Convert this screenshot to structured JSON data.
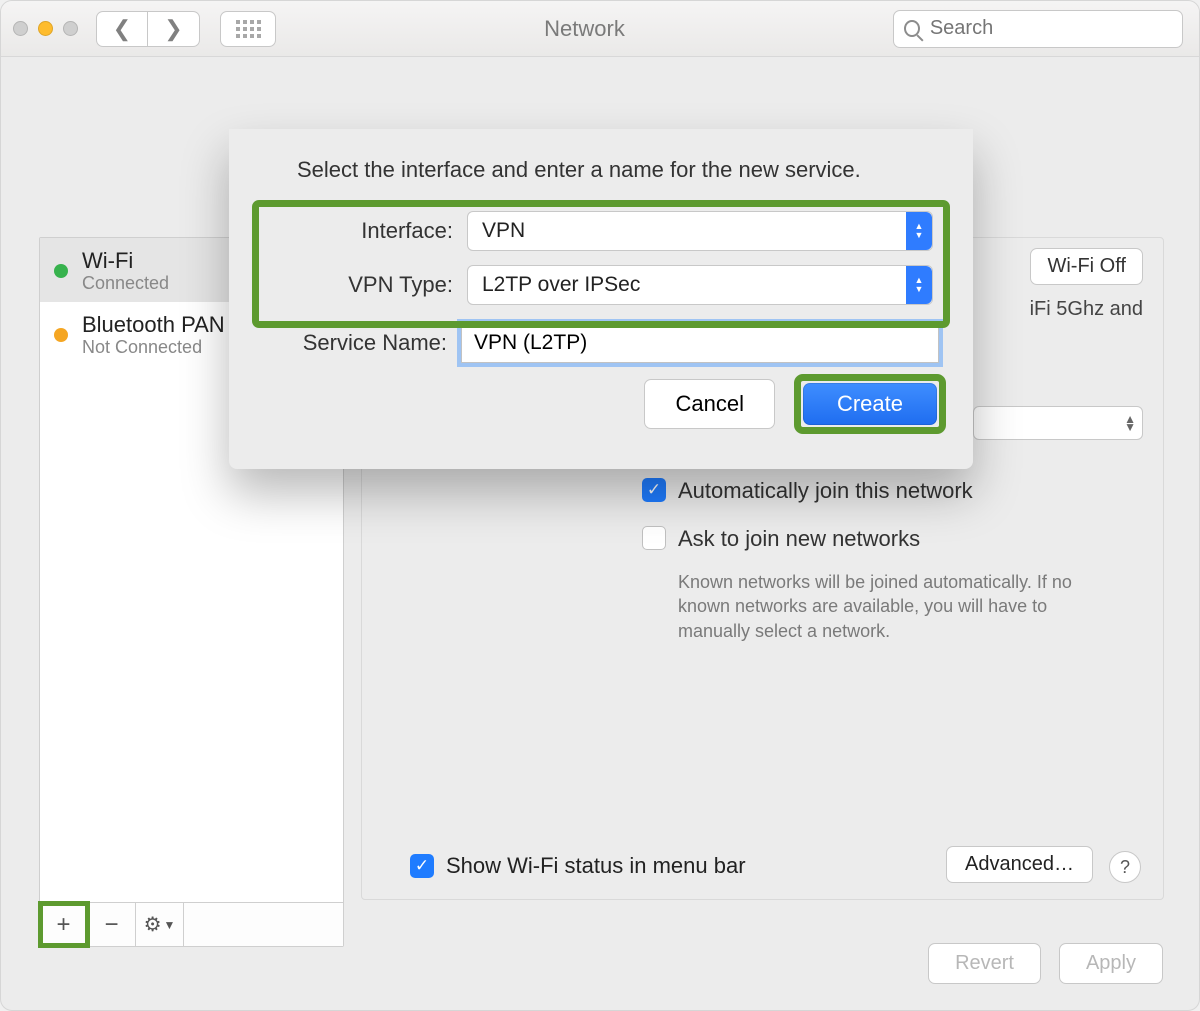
{
  "window": {
    "title": "Network"
  },
  "search": {
    "placeholder": "Search"
  },
  "sidebar": {
    "items": [
      {
        "name": "Wi-Fi",
        "status": "Connected"
      },
      {
        "name": "Bluetooth PAN",
        "status": "Not Connected"
      }
    ]
  },
  "sheet": {
    "instruction": "Select the interface and enter a name for the new service.",
    "interface_label": "Interface:",
    "interface_value": "VPN",
    "vpn_type_label": "VPN Type:",
    "vpn_type_value": "L2TP over IPSec",
    "service_name_label": "Service Name:",
    "service_name_value": "VPN (L2TP)",
    "cancel": "Cancel",
    "create": "Create"
  },
  "right": {
    "wifi_off": "Wi-Fi Off",
    "network_hint": "iFi 5Ghz and",
    "auto_join": "Automatically join this network",
    "ask_join": "Ask to join new networks",
    "ask_help": "Known networks will be joined automatically. If no known networks are available, you will have to manually select a network.",
    "menu_bar": "Show Wi-Fi status in menu bar",
    "advanced": "Advanced…",
    "help": "?"
  },
  "footer": {
    "revert": "Revert",
    "apply": "Apply"
  }
}
